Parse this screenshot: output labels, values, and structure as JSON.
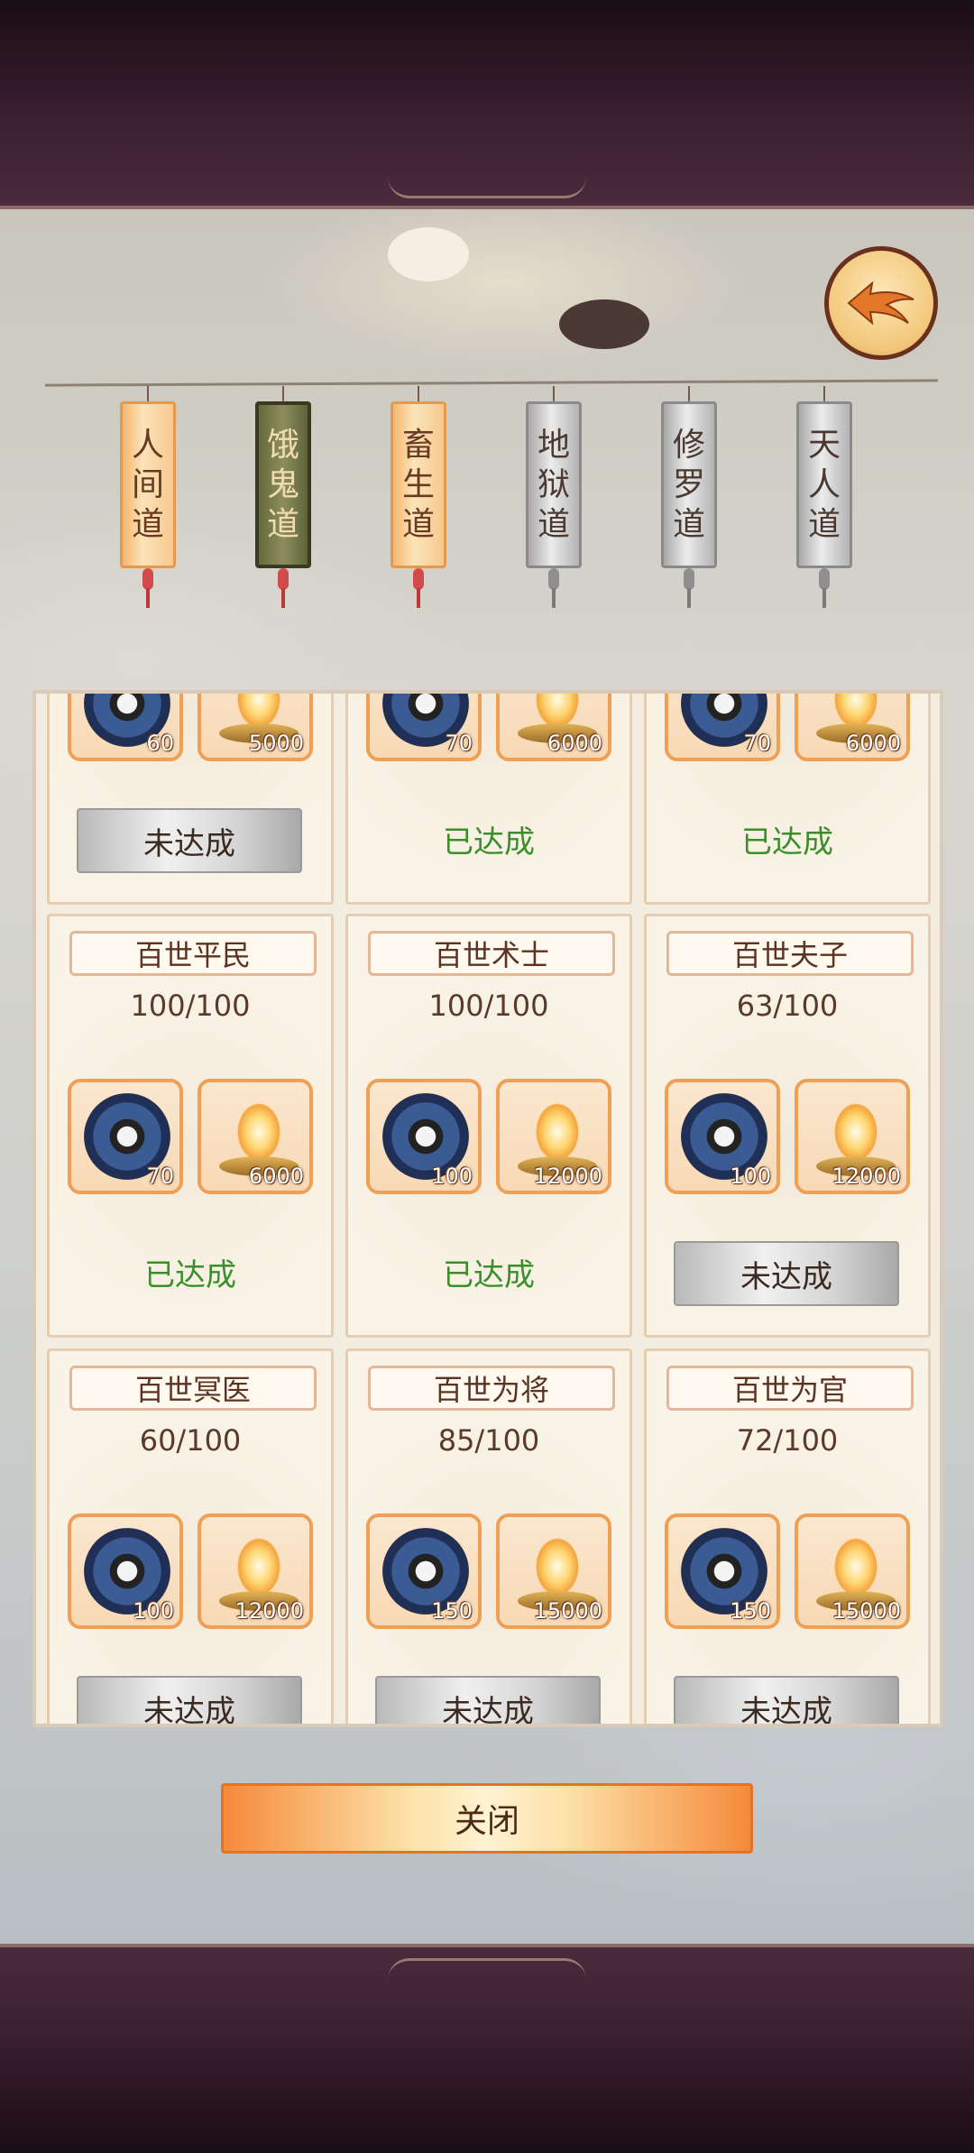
{
  "tabs": [
    {
      "label": "人\n间\n道",
      "style": "orange"
    },
    {
      "label": "饿\n鬼\n道",
      "style": "active"
    },
    {
      "label": "畜\n生\n道",
      "style": "orange"
    },
    {
      "label": "地\n狱\n道",
      "style": "gray"
    },
    {
      "label": "修\n罗\n道",
      "style": "gray"
    },
    {
      "label": "天\n人\n道",
      "style": "gray"
    }
  ],
  "cards": [
    {
      "title": "",
      "progress": "",
      "rewards": [
        "60",
        "5000"
      ],
      "status": "未达成",
      "achieved": false
    },
    {
      "title": "",
      "progress": "",
      "rewards": [
        "70",
        "6000"
      ],
      "status": "已达成",
      "achieved": true
    },
    {
      "title": "",
      "progress": "",
      "rewards": [
        "70",
        "6000"
      ],
      "status": "已达成",
      "achieved": true
    },
    {
      "title": "百世平民",
      "progress": "100/100",
      "rewards": [
        "70",
        "6000"
      ],
      "status": "已达成",
      "achieved": true
    },
    {
      "title": "百世术士",
      "progress": "100/100",
      "rewards": [
        "100",
        "12000"
      ],
      "status": "已达成",
      "achieved": true
    },
    {
      "title": "百世夫子",
      "progress": "63/100",
      "rewards": [
        "100",
        "12000"
      ],
      "status": "未达成",
      "achieved": false
    },
    {
      "title": "百世冥医",
      "progress": "60/100",
      "rewards": [
        "100",
        "12000"
      ],
      "status": "未达成",
      "achieved": false
    },
    {
      "title": "百世为将",
      "progress": "85/100",
      "rewards": [
        "150",
        "15000"
      ],
      "status": "未达成",
      "achieved": false
    },
    {
      "title": "百世为官",
      "progress": "72/100",
      "rewards": [
        "150",
        "15000"
      ],
      "status": "未达成",
      "achieved": false
    }
  ],
  "close_label": "关闭",
  "icons": {
    "back": "back-arrow-icon",
    "reward1": "compass-icon",
    "reward2": "flame-icon"
  }
}
